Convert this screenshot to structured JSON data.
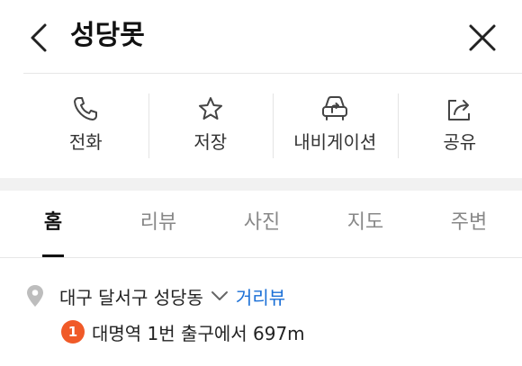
{
  "header": {
    "title": "성당못"
  },
  "actions": [
    {
      "label": "전화",
      "icon": "phone-icon"
    },
    {
      "label": "저장",
      "icon": "star-icon"
    },
    {
      "label": "내비게이션",
      "icon": "car-navigation-icon"
    },
    {
      "label": "공유",
      "icon": "share-icon"
    }
  ],
  "tabs": [
    {
      "label": "홈",
      "active": true
    },
    {
      "label": "리뷰",
      "active": false
    },
    {
      "label": "사진",
      "active": false
    },
    {
      "label": "지도",
      "active": false
    },
    {
      "label": "주변",
      "active": false
    }
  ],
  "place": {
    "address": "대구 달서구 성당동",
    "roadview_label": "거리뷰",
    "subway_line": "1",
    "subway_line_color": "#f05a28",
    "nearest_station": "대명역 1번 출구에서 697m"
  },
  "colors": {
    "link": "#1a6fd6",
    "text": "#1a1a1a"
  }
}
